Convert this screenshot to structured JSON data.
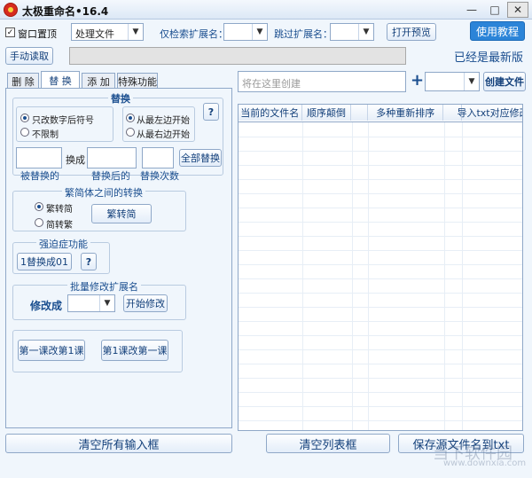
{
  "window": {
    "title": "太极重命名•16.4",
    "minimize": "—",
    "maximize": "□",
    "close": "✕"
  },
  "toolbar": {
    "topmost_checked": "✓",
    "topmost_label": "窗口置顶",
    "mode_value": "处理文件",
    "search_ext_label": "仅检索扩展名：",
    "search_ext_value": "",
    "skip_ext_label": "跳过扩展名：",
    "skip_ext_value": "",
    "open_preview": "打开预览",
    "tutorial": "使用教程",
    "manual_read": "手动读取",
    "path_value": "",
    "version_status": "已经是最新版"
  },
  "tabs": [
    {
      "label": "删 除"
    },
    {
      "label": "替 换"
    },
    {
      "label": "添 加"
    },
    {
      "label": "特殊功能"
    }
  ],
  "replace": {
    "title": "替换",
    "opt_digits": "只改数字后符号",
    "opt_unlimited": "不限制",
    "opt_from_left": "从最左边开始",
    "opt_from_right": "从最右边开始",
    "help": "?",
    "to_label": "换成",
    "replaced_caption": "被替换的",
    "after_caption": "替换后的",
    "count_caption": "替换次数",
    "replace_all": "全部替换",
    "replaced_value": "",
    "after_value": "",
    "count_value": ""
  },
  "convert": {
    "title": "繁简体之间的转换",
    "opt_to_simplified": "繁转简",
    "opt_to_traditional": "简转繁",
    "button": "繁转简"
  },
  "ocd": {
    "title": "强迫症功能",
    "button": "1替换成01",
    "help": "?"
  },
  "batch_ext": {
    "title": "批量修改扩展名",
    "label": "修改成",
    "value": "",
    "button": "开始修改"
  },
  "lessons": {
    "btn1": "第一课改第1课",
    "btn2": "第1课改第一课"
  },
  "right": {
    "create_placeholder": "将在这里创建",
    "plus": "+",
    "ext_value": "",
    "create_button": "创建文件",
    "columns": [
      "当前的文件名",
      "顺序颠倒",
      "多种重新排序",
      "导入txt对应修改"
    ]
  },
  "bottom": {
    "clear_inputs": "清空所有输入框",
    "clear_list": "清空列表框",
    "save_txt": "保存源文件名到txt"
  },
  "watermark": {
    "text": "当下软件园",
    "url": "www.downxia.com"
  }
}
